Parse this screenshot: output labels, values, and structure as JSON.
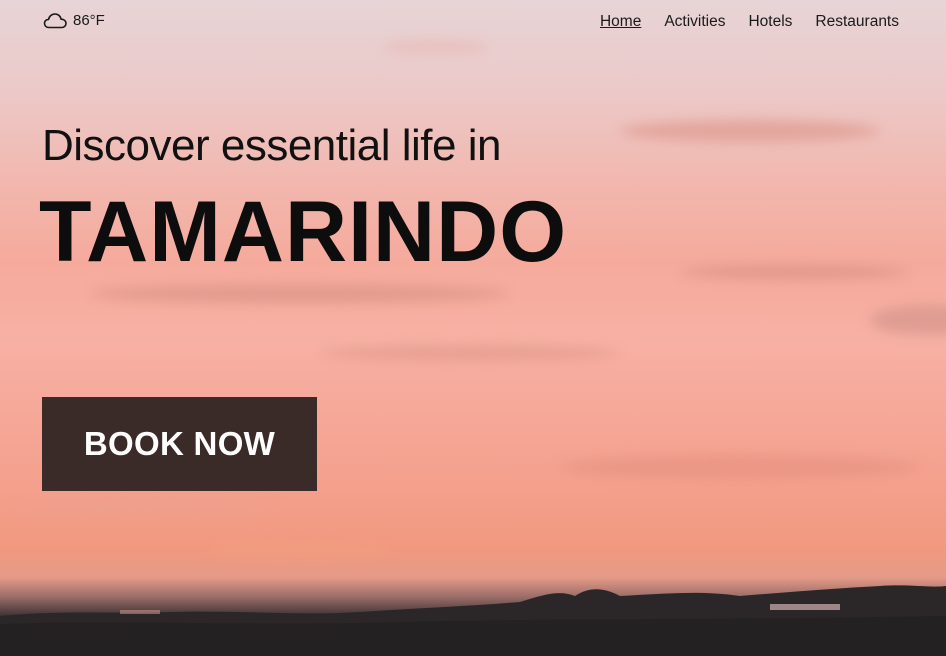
{
  "weather": {
    "icon": "cloud-icon",
    "temperature": "86°F"
  },
  "nav": {
    "items": [
      {
        "label": "Home",
        "active": true
      },
      {
        "label": "Activities",
        "active": false
      },
      {
        "label": "Hotels",
        "active": false
      },
      {
        "label": "Restaurants",
        "active": false
      }
    ]
  },
  "hero": {
    "headline": "Discover essential life in",
    "place": "TAMARINDO",
    "cta_label": "BOOK NOW"
  },
  "colors": {
    "cta_background": "#3a2a28",
    "cta_text": "#ffffff",
    "text": "#111111",
    "sky_top": "#e7d4d6",
    "sky_mid": "#f5aa9c",
    "ground": "#2b2728"
  }
}
